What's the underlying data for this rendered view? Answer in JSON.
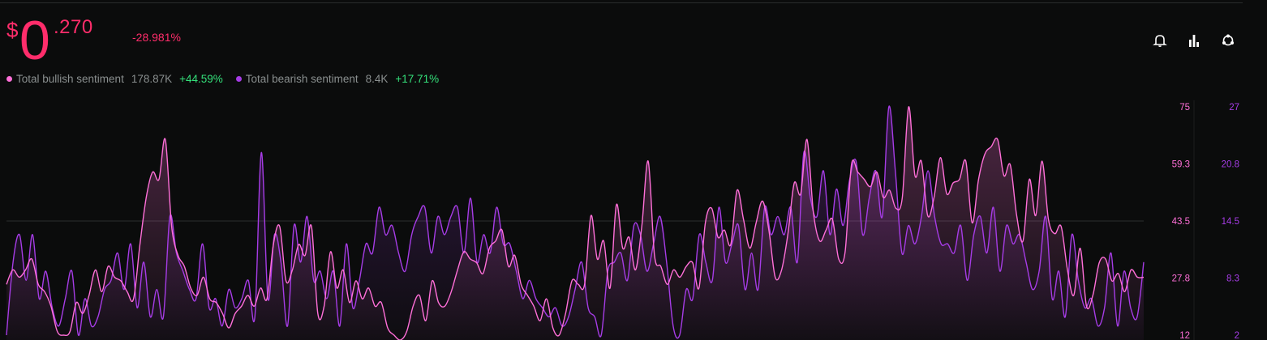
{
  "price": {
    "currency": "$",
    "integer": "0",
    "decimal": ".270",
    "change": "-28.981%"
  },
  "legend": [
    {
      "label": "Total bullish sentiment",
      "value": "178.87K",
      "change": "+44.59%",
      "color": "#ff6fd8"
    },
    {
      "label": "Total bearish sentiment",
      "value": "8.4K",
      "change": "+17.71%",
      "color": "#a63ce6"
    }
  ],
  "toolbar": {
    "icons": [
      "bell-icon",
      "bar-chart-icon",
      "share-icon"
    ]
  },
  "colors": {
    "bullish": "#ff6fd8",
    "bearish": "#a63ce6",
    "negative": "#ff2d6b",
    "positive": "#34e07a",
    "background": "#0b0c0c"
  },
  "chart_data": {
    "type": "line",
    "series": [
      {
        "name": "Total bullish sentiment",
        "axis": "left",
        "color": "#ff6fd8",
        "values": [
          26,
          30,
          28,
          30,
          33,
          26,
          24,
          20,
          13,
          12,
          13,
          21,
          18,
          23,
          30,
          24,
          31,
          28,
          27,
          24,
          22,
          37,
          50,
          57,
          55,
          66,
          42,
          34,
          31,
          25,
          23,
          28,
          22,
          21,
          18,
          14,
          18,
          20,
          23,
          20,
          25,
          22,
          37,
          42,
          27,
          30,
          37,
          34,
          42,
          18,
          20,
          35,
          25,
          30,
          21,
          27,
          22,
          25,
          20,
          21,
          14,
          12,
          10,
          13,
          20,
          23,
          16,
          27,
          21,
          20,
          24,
          30,
          35,
          33,
          32,
          29,
          36,
          38,
          41,
          31,
          34,
          26,
          23,
          20,
          16,
          22,
          14,
          12,
          18,
          27,
          26,
          26,
          45,
          33,
          38,
          25,
          48,
          36,
          39,
          30,
          42,
          60,
          34,
          31,
          26,
          30,
          28,
          31,
          32,
          25,
          43,
          47,
          39,
          41,
          37,
          52,
          44,
          36,
          43,
          49,
          41,
          28,
          30,
          40,
          54,
          51,
          66,
          46,
          38,
          41,
          44,
          33,
          35,
          59,
          57,
          55,
          53,
          57,
          50,
          52,
          47,
          50,
          76,
          56,
          60,
          45,
          50,
          61,
          51,
          54,
          55,
          60,
          43,
          55,
          62,
          64,
          66,
          56,
          59,
          45,
          38,
          55,
          45,
          60,
          44,
          40,
          42,
          30,
          23,
          36,
          20,
          23,
          32,
          33,
          27,
          29,
          24,
          30,
          28,
          28
        ]
      },
      {
        "name": "Total bearish sentiment",
        "axis": "right",
        "color": "#a63ce6",
        "values": [
          2,
          10,
          13,
          8,
          13,
          6,
          9,
          5,
          3,
          6,
          9,
          2,
          6,
          3,
          4,
          7,
          8,
          11,
          7,
          12,
          5,
          10,
          4,
          7,
          4,
          15,
          11,
          9,
          7,
          6,
          12,
          5,
          6,
          3,
          7,
          5,
          6,
          8,
          4,
          22,
          6,
          13,
          10,
          3,
          14,
          10,
          15,
          8,
          9,
          6,
          9,
          3,
          12,
          5,
          8,
          12,
          11,
          16,
          13,
          14,
          11,
          9,
          13,
          15,
          16,
          11,
          15,
          13,
          15,
          16,
          11,
          17,
          10,
          13,
          11,
          16,
          12,
          12,
          9,
          6,
          8,
          6,
          5,
          4,
          5,
          3,
          4,
          7,
          10,
          5,
          4,
          2,
          9,
          10,
          11,
          8,
          14,
          13,
          9,
          12,
          15,
          10,
          3,
          2,
          7,
          6,
          13,
          10,
          8,
          16,
          10,
          12,
          14,
          7,
          11,
          7,
          16,
          13,
          15,
          13,
          16,
          10,
          22,
          17,
          15,
          20,
          13,
          18,
          14,
          19,
          21,
          13,
          17,
          20,
          15,
          27,
          20,
          11,
          14,
          12,
          15,
          20,
          15,
          12,
          12,
          11,
          14,
          8,
          13,
          15,
          11,
          16,
          9,
          14,
          12,
          13,
          10,
          7,
          9,
          15,
          6,
          9,
          4,
          13,
          8,
          5,
          6,
          3,
          5,
          11,
          3,
          9,
          5,
          4,
          10
        ]
      }
    ],
    "left_ticks": [
      "75",
      "59.3",
      "43.5",
      "27.8",
      "12"
    ],
    "right_ticks": [
      "27",
      "20.8",
      "14.5",
      "8.3",
      "2"
    ],
    "ylim_left": [
      12,
      75
    ],
    "ylim_right": [
      2,
      27
    ],
    "grid_at_left": 43.5
  }
}
